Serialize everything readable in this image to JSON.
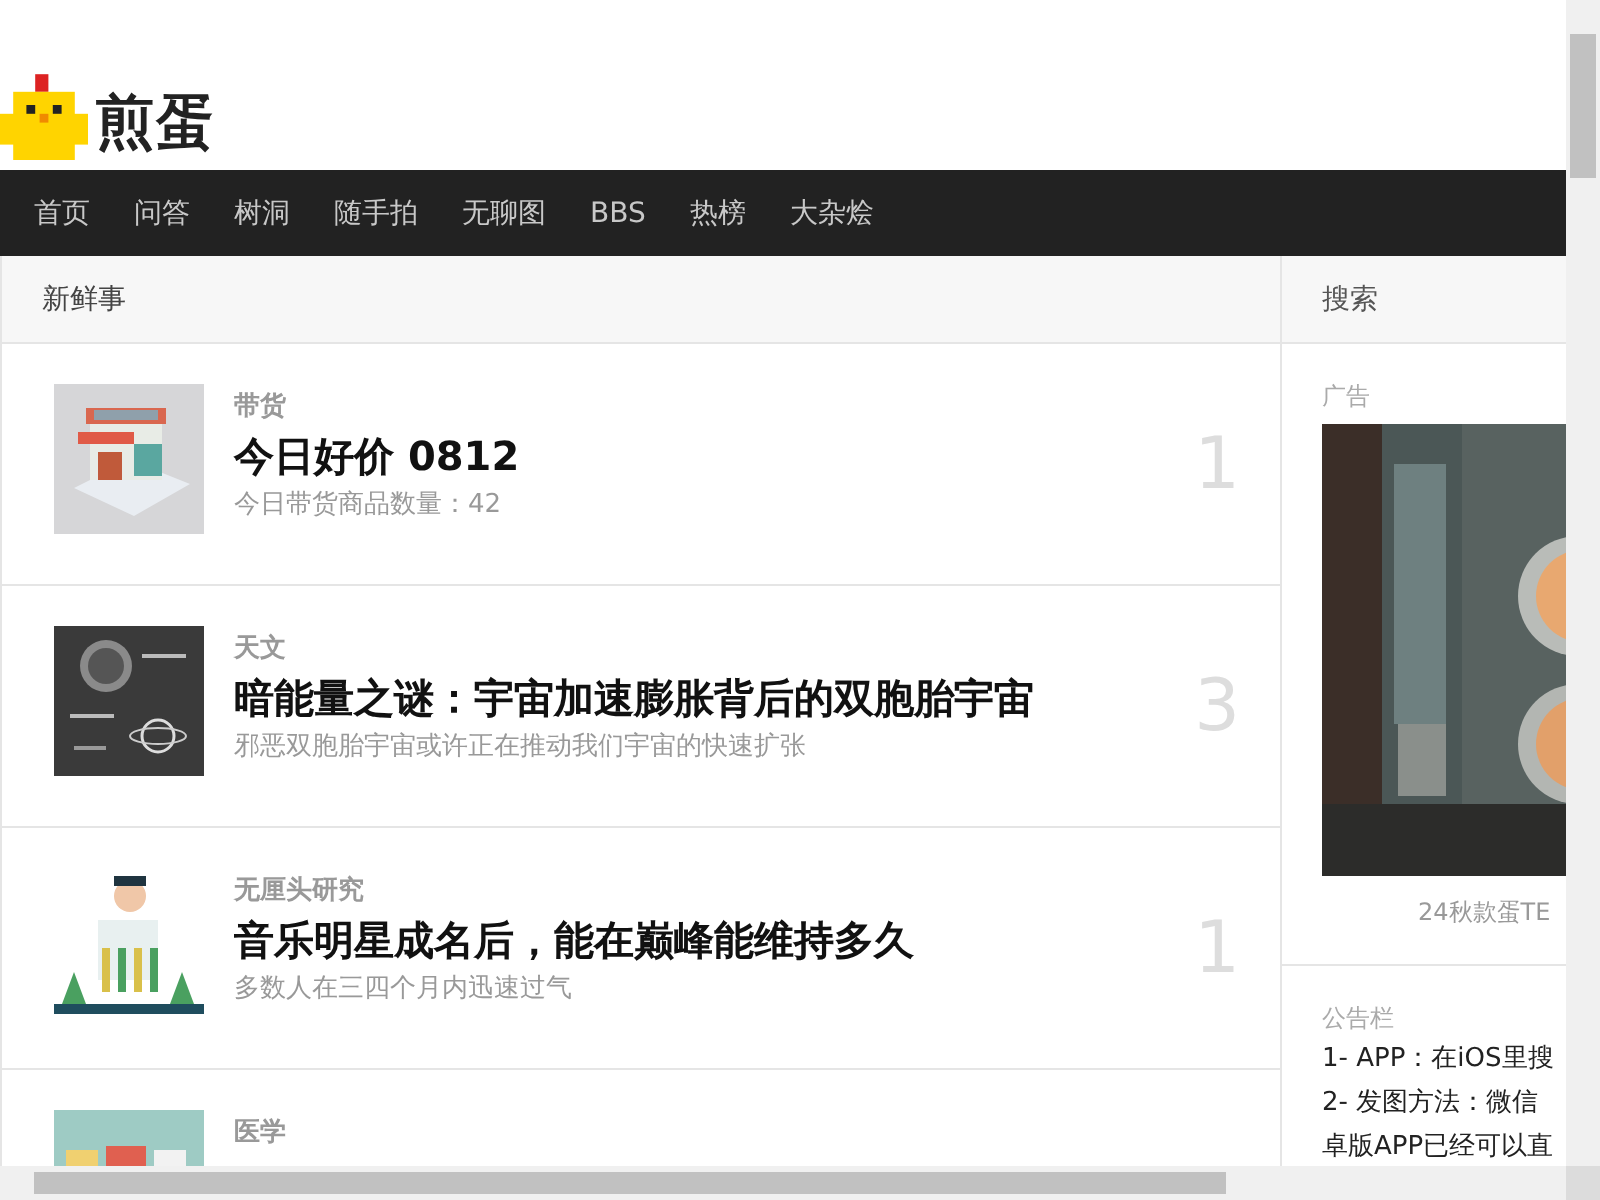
{
  "logo": {
    "text": "煎蛋"
  },
  "nav": [
    {
      "label": "首页"
    },
    {
      "label": "问答"
    },
    {
      "label": "树洞"
    },
    {
      "label": "随手拍"
    },
    {
      "label": "无聊图"
    },
    {
      "label": "BBS"
    },
    {
      "label": "热榜"
    },
    {
      "label": "大杂烩"
    }
  ],
  "feed": {
    "title": "新鲜事",
    "posts": [
      {
        "category": "带货",
        "title": "今日好价 0812",
        "summary": "今日带货商品数量：42",
        "rank": "1"
      },
      {
        "category": "天文",
        "title": "暗能量之谜：宇宙加速膨胀背后的双胞胎宇宙",
        "summary": "邪恶双胞胎宇宙或许正在推动我们宇宙的快速扩张",
        "rank": "3"
      },
      {
        "category": "无厘头研究",
        "title": "音乐明星成名后，能在巅峰能维持多久",
        "summary": "多数人在三四个月内迅速过气",
        "rank": "1"
      },
      {
        "category": "医学"
      }
    ]
  },
  "sidebar": {
    "search_title": "搜索",
    "ad": {
      "label": "广告",
      "caption": "24秋款蛋TE"
    },
    "notice": {
      "label": "公告栏",
      "lines": [
        "1- APP：在iOS里搜",
        "2- 发图方法：微信",
        "卓版APP已经可以直"
      ]
    }
  }
}
